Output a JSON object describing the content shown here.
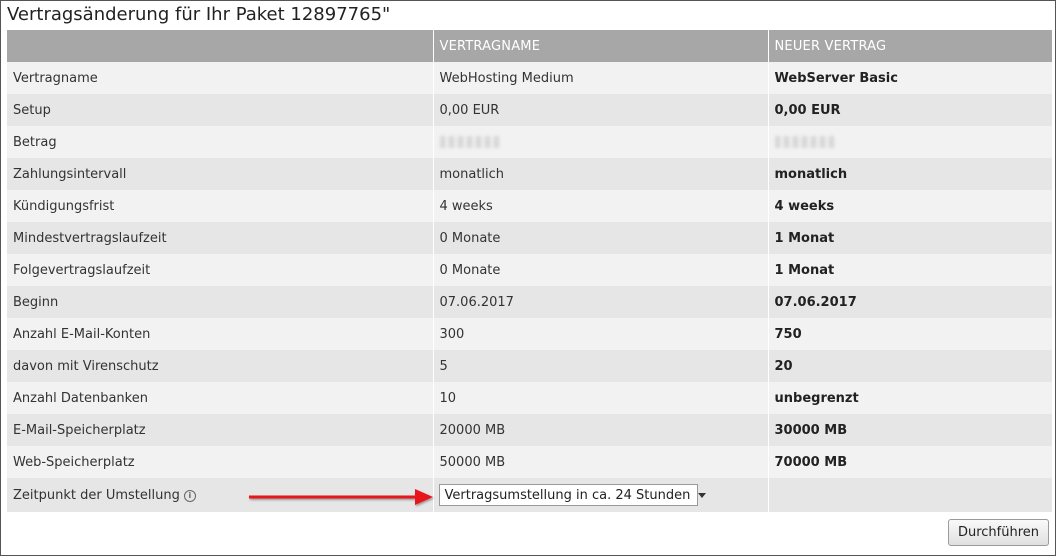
{
  "title": "Vertragsänderung für Ihr Paket 12897765\"",
  "table": {
    "headers": [
      "",
      "VERTRAGNAME",
      "NEUER VERTRAG"
    ],
    "rows": [
      {
        "label": "Vertragname",
        "current": "WebHosting Medium",
        "new": "WebServer Basic"
      },
      {
        "label": "Setup",
        "current": "0,00 EUR",
        "new": "0,00 EUR"
      },
      {
        "label": "Betrag",
        "current": "",
        "new": ""
      },
      {
        "label": "Zahlungsintervall",
        "current": "monatlich",
        "new": "monatlich"
      },
      {
        "label": "Kündigungsfrist",
        "current": "4 weeks",
        "new": "4 weeks"
      },
      {
        "label": "Mindestvertragslaufzeit",
        "current": "0 Monate",
        "new": "1 Monat"
      },
      {
        "label": "Folgevertragslaufzeit",
        "current": "0 Monate",
        "new": "1 Monat"
      },
      {
        "label": "Beginn",
        "current": "07.06.2017",
        "new": "07.06.2017"
      },
      {
        "label": "Anzahl E-Mail-Konten",
        "current": "300",
        "new": "750"
      },
      {
        "label": "davon mit Virenschutz",
        "current": "5",
        "new": "20"
      },
      {
        "label": "Anzahl Datenbanken",
        "current": "10",
        "new": "unbegrenzt"
      },
      {
        "label": "E-Mail-Speicherplatz",
        "current": "20000 MB",
        "new": "30000 MB"
      },
      {
        "label": "Web-Speicherplatz",
        "current": "50000 MB",
        "new": "70000 MB"
      }
    ],
    "switch_row": {
      "label": "Zeitpunkt der Umstellung",
      "info_icon": "info-icon",
      "select_value": "Vertragsumstellung in ca. 24 Stunden"
    }
  },
  "annotation": {
    "arrow_color": "#e8141b"
  },
  "submit_label": "Durchführen"
}
